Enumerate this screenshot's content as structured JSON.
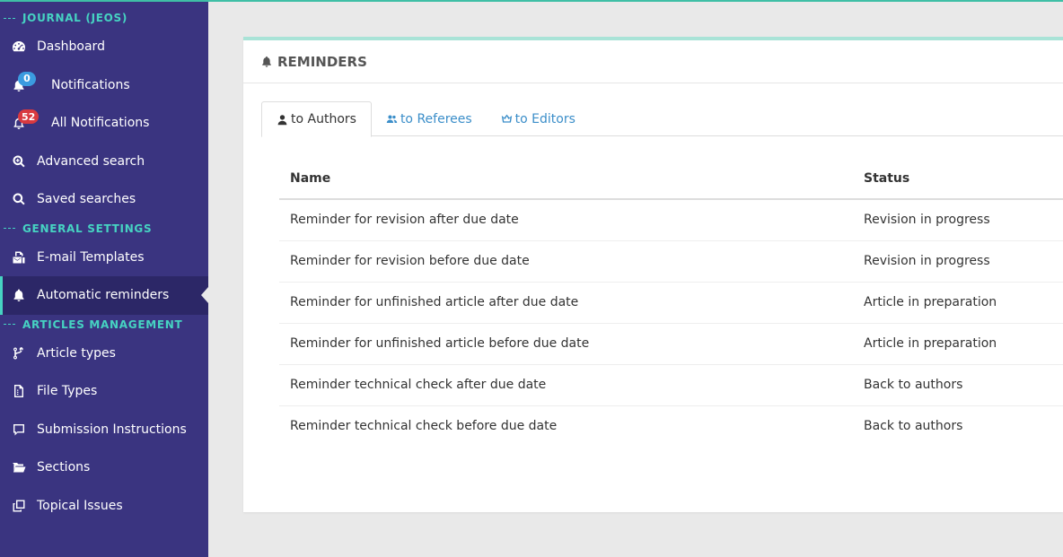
{
  "sidebar": {
    "sections": [
      {
        "title": "JOURNAL (JEOS)",
        "items": [
          {
            "label": "Dashboard",
            "icon": "dashboard-icon"
          },
          {
            "label": "Notifications",
            "icon": "bell-icon",
            "badge": "0",
            "badge_color": "#3b9be0"
          },
          {
            "label": "All Notifications",
            "icon": "bell-outline-icon",
            "badge": "52",
            "badge_color": "#d9393f"
          },
          {
            "label": "Advanced search",
            "icon": "search-plus-icon"
          },
          {
            "label": "Saved searches",
            "icon": "search-icon"
          }
        ]
      },
      {
        "title": "GENERAL SETTINGS",
        "items": [
          {
            "label": "E-mail Templates",
            "icon": "email-templates-icon"
          },
          {
            "label": "Automatic reminders",
            "icon": "bell-icon",
            "active": true
          }
        ]
      },
      {
        "title": "ARTICLES MANAGEMENT",
        "items": [
          {
            "label": "Article types",
            "icon": "code-branch-icon"
          },
          {
            "label": "File Types",
            "icon": "file-icon"
          },
          {
            "label": "Submission Instructions",
            "icon": "comment-icon"
          },
          {
            "label": "Sections",
            "icon": "folder-open-icon"
          },
          {
            "label": "Topical Issues",
            "icon": "copy-icon"
          }
        ]
      }
    ]
  },
  "panel": {
    "title": "REMINDERS",
    "tabs": [
      {
        "label": "to Authors",
        "icon": "user-icon",
        "active": true
      },
      {
        "label": "to Referees",
        "icon": "users-icon"
      },
      {
        "label": "to Editors",
        "icon": "crown-icon"
      }
    ],
    "table": {
      "columns": [
        "Name",
        "Status"
      ],
      "rows": [
        [
          "Reminder for revision after due date",
          "Revision in progress"
        ],
        [
          "Reminder for revision before due date",
          "Revision in progress"
        ],
        [
          "Reminder for unfinished article after due date",
          "Article in preparation"
        ],
        [
          "Reminder for unfinished article before due date",
          "Article in preparation"
        ],
        [
          "Reminder technical check after due date",
          "Back to authors"
        ],
        [
          "Reminder technical check before due date",
          "Back to authors"
        ]
      ]
    }
  },
  "colors": {
    "sidebar_bg": "#3a3480",
    "section_accent": "#46d3c2",
    "link_blue": "#3b8ec9",
    "panel_top_border": "#a9e3d7"
  }
}
